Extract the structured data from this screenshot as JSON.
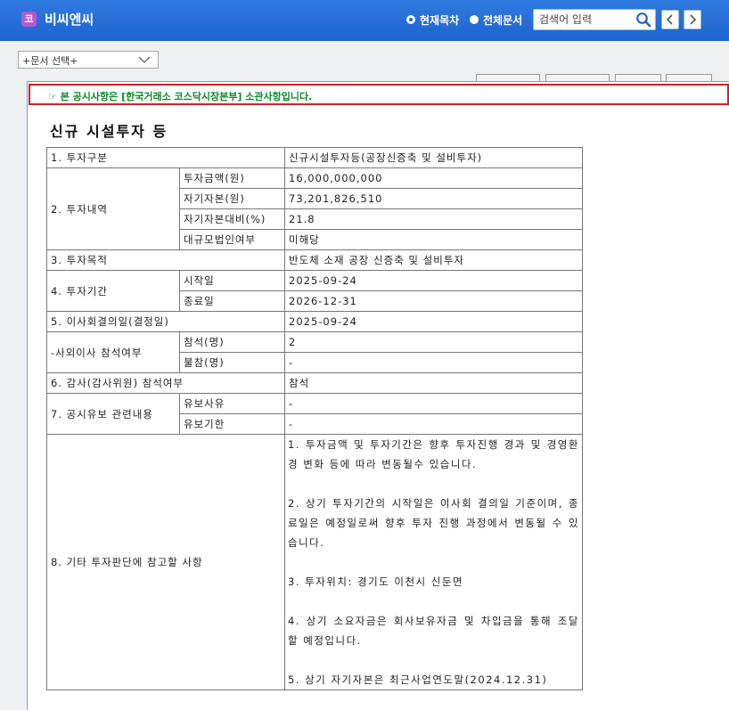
{
  "header": {
    "logo_char": "코",
    "company_name": "비씨엔씨",
    "radio_current": "현재목차",
    "radio_all": "전체문서",
    "search_placeholder": "검색어 입력"
  },
  "doc_select": {
    "label": "+문서 선택+"
  },
  "notice": "☞ 본 공시사항은 [한국거래소 코스닥시장본부] 소관사항입니다.",
  "title": "신규 시설투자 등",
  "table": {
    "r1": {
      "label": "1. 투자구분",
      "value": "신규시설투자등(공장신증축 및 설비투자)"
    },
    "r2": {
      "label": "2. 투자내역",
      "items": [
        {
          "label": "투자금액(원)",
          "value": "16,000,000,000"
        },
        {
          "label": "자기자본(원)",
          "value": "73,201,826,510"
        },
        {
          "label": "자기자본대비(%)",
          "value": "21.8"
        },
        {
          "label": "대규모법인여부",
          "value": "미해당"
        }
      ]
    },
    "r3": {
      "label": "3. 투자목적",
      "value": "반도체 소재 공장 신증축 및 설비투자"
    },
    "r4": {
      "label": "4. 투자기간",
      "items": [
        {
          "label": "시작일",
          "value": "2025-09-24"
        },
        {
          "label": "종료일",
          "value": "2026-12-31"
        }
      ]
    },
    "r5": {
      "label": "5. 이사회결의일(결정일)",
      "value": "2025-09-24"
    },
    "r5b": {
      "label": "-사외이사 참석여부",
      "items": [
        {
          "label": "참석(명)",
          "value": "2"
        },
        {
          "label": "불참(명)",
          "value": "-"
        }
      ]
    },
    "r6": {
      "label": "6. 감사(감사위원) 참석여부",
      "value": "참석"
    },
    "r7": {
      "label": "7. 공시유보 관련내용",
      "items": [
        {
          "label": "유보사유",
          "value": "-"
        },
        {
          "label": "유보기한",
          "value": "-"
        }
      ]
    },
    "r8": {
      "label": "8. 기타 투자판단에 참고할 사항",
      "paragraphs": [
        "1. 투자금액 및 투자기간은 향후 투자진행 경과 및 경영환경 변화 등에 따라 변동될수 있습니다.",
        "2. 상기 투자기간의 시작일은 이사회 결의일 기준이며, 종료일은 예정일로써 향후 투자 진행 과정에서 변동될 수 있습니다.",
        "3. 투자위치: 경기도 이천시 신둔면",
        "4. 상기 소요자금은 회사보유자금 및 차입금을 통해 조달할 예정입니다.",
        "5. 상기 자기자본은 최근사업연도말(2024.12.31)"
      ]
    }
  }
}
